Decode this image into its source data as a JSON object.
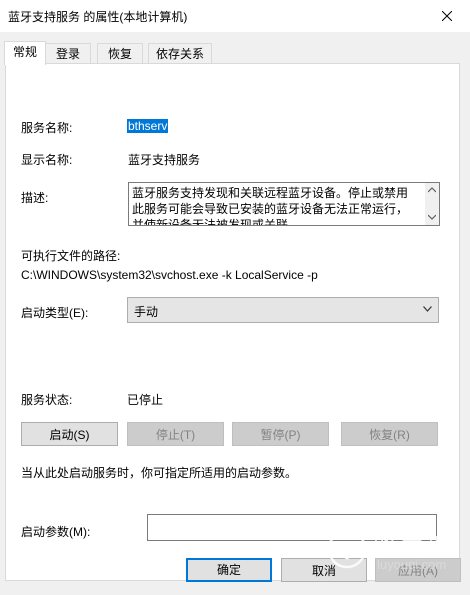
{
  "window": {
    "title": "蓝牙支持服务 的属性(本地计算机)"
  },
  "tabs": [
    {
      "label": "常规",
      "active": true
    },
    {
      "label": "登录"
    },
    {
      "label": "恢复"
    },
    {
      "label": "依存关系"
    }
  ],
  "general": {
    "service_name_label": "服务名称:",
    "service_name": "bthserv",
    "display_name_label": "显示名称:",
    "display_name": "蓝牙支持服务",
    "description_label": "描述:",
    "description": "蓝牙服务支持发现和关联远程蓝牙设备。停止或禁用此服务可能会导致已安装的蓝牙设备无法正常运行，并使新设备无法被发现或关联",
    "path_label": "可执行文件的路径:",
    "path": "C:\\WINDOWS\\system32\\svchost.exe -k LocalService -p",
    "startup_type_label": "启动类型(E):",
    "startup_type": "手动",
    "status_label": "服务状态:",
    "status": "已停止",
    "start_button": "启动(S)",
    "stop_button": "停止(T)",
    "pause_button": "暂停(P)",
    "resume_button": "恢复(R)",
    "hint": "当从此处启动服务时，你可指定所适用的启动参数。",
    "params_label": "启动参数(M):",
    "params_value": ""
  },
  "footer": {
    "ok": "确定",
    "cancel": "取消",
    "apply": "应用(A)"
  },
  "watermark": {
    "title": "路由器",
    "url": "luyouqi.com"
  }
}
